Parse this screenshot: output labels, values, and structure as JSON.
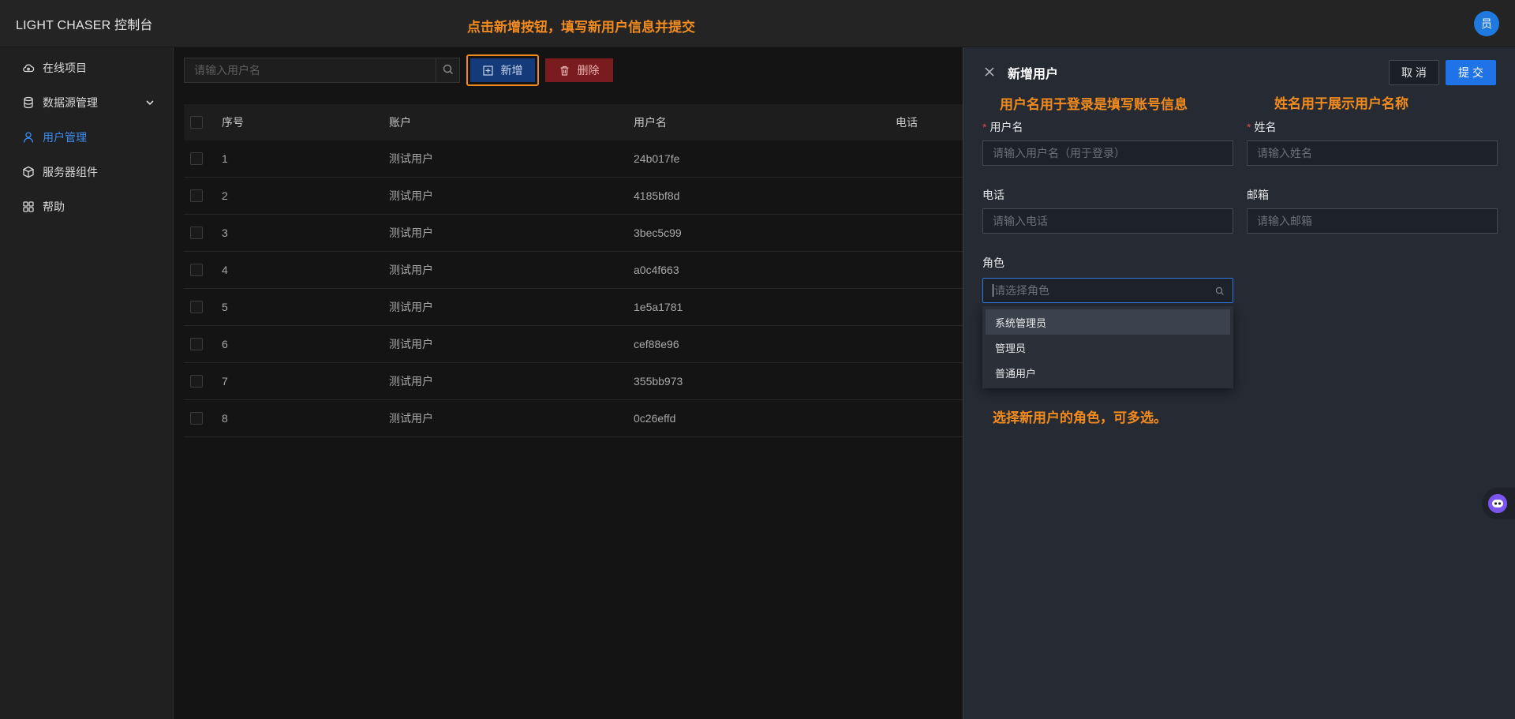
{
  "header": {
    "app_title": "LIGHT CHASER 控制台",
    "annotation": "点击新增按钮，填写新用户信息并提交",
    "avatar_text": "员"
  },
  "sidebar": {
    "items": [
      {
        "label": "在线项目",
        "icon": "cloud-icon"
      },
      {
        "label": "数据源管理",
        "icon": "database-icon",
        "expandable": true
      },
      {
        "label": "用户管理",
        "icon": "user-icon",
        "active": true
      },
      {
        "label": "服务器组件",
        "icon": "box-icon"
      },
      {
        "label": "帮助",
        "icon": "grid-icon"
      }
    ]
  },
  "toolbar": {
    "search_placeholder": "请输入用户名",
    "add_label": "新增",
    "delete_label": "删除"
  },
  "table": {
    "columns": [
      "序号",
      "账户",
      "用户名",
      "电话"
    ],
    "rows": [
      {
        "index": "1",
        "account": "测试用户",
        "username": "24b017fe"
      },
      {
        "index": "2",
        "account": "测试用户",
        "username": "4185bf8d"
      },
      {
        "index": "3",
        "account": "测试用户",
        "username": "3bec5c99"
      },
      {
        "index": "4",
        "account": "测试用户",
        "username": "a0c4f663"
      },
      {
        "index": "5",
        "account": "测试用户",
        "username": "1e5a1781"
      },
      {
        "index": "6",
        "account": "测试用户",
        "username": "cef88e96"
      },
      {
        "index": "7",
        "account": "测试用户",
        "username": "355bb973"
      },
      {
        "index": "8",
        "account": "测试用户",
        "username": "0c26effd"
      }
    ]
  },
  "drawer": {
    "title": "新增用户",
    "cancel_label": "取 消",
    "submit_label": "提 交",
    "annotation_username": "用户名用于登录是填写账号信息",
    "annotation_name": "姓名用于展示用户名称",
    "annotation_role": "选择新用户的角色，可多选。",
    "fields": {
      "username_label": "用户名",
      "username_placeholder": "请输入用户名（用于登录）",
      "name_label": "姓名",
      "name_placeholder": "请输入姓名",
      "phone_label": "电话",
      "phone_placeholder": "请输入电话",
      "email_label": "邮箱",
      "email_placeholder": "请输入邮箱",
      "role_label": "角色",
      "role_placeholder": "请选择角色"
    },
    "role_options": [
      "系统管理员",
      "管理员",
      "普通用户"
    ]
  },
  "colors": {
    "accent": "#1f73e6",
    "annotation": "#f28b1f",
    "danger": "#7a1c1f"
  }
}
